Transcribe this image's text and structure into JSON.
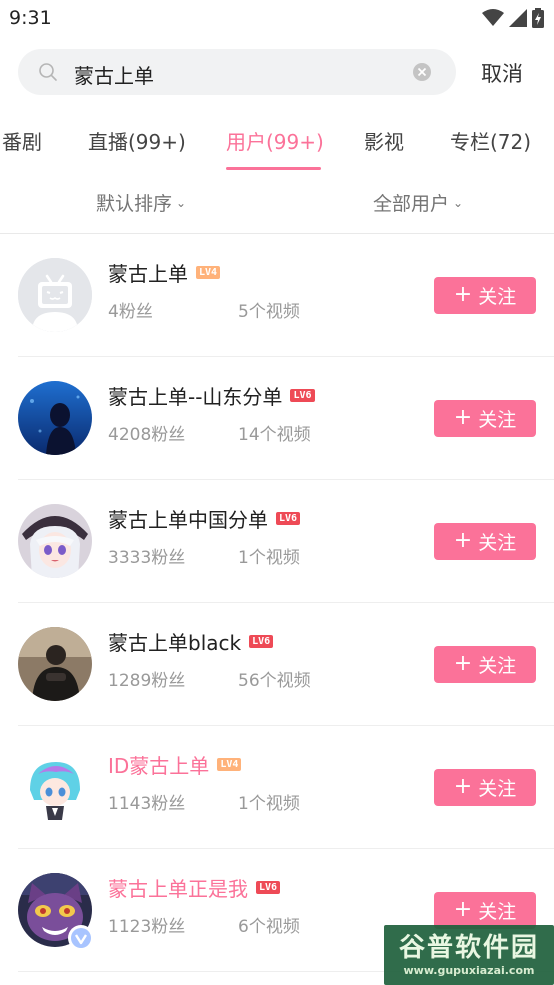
{
  "status": {
    "time": "9:31"
  },
  "search": {
    "query": "蒙古上单",
    "cancel_label": "取消"
  },
  "tabs": [
    {
      "label": "番剧"
    },
    {
      "label": "直播(99+)"
    },
    {
      "label": "用户(99+)"
    },
    {
      "label": "影视"
    },
    {
      "label": "专栏(72)"
    }
  ],
  "active_tab": "用户(99+)",
  "filters": {
    "sort_label": "默认排序",
    "type_label": "全部用户"
  },
  "users": [
    {
      "name": "蒙古上单",
      "level": "LV4",
      "fans": "4粉丝",
      "videos": "5个视频",
      "follow_label": "关注",
      "avatar": "default-tv-avatar"
    },
    {
      "name": "蒙古上单--山东分单",
      "level": "LV6",
      "fans": "4208粉丝",
      "videos": "14个视频",
      "follow_label": "关注",
      "avatar": "aquarium-photo-avatar"
    },
    {
      "name": "蒙古上单中国分单",
      "level": "LV6",
      "fans": "3333粉丝",
      "videos": "1个视频",
      "follow_label": "关注",
      "avatar": "anime-girl-avatar"
    },
    {
      "name": "蒙古上单black",
      "level": "LV6",
      "fans": "1289粉丝",
      "videos": "56个视频",
      "follow_label": "关注",
      "avatar": "man-photo-avatar"
    },
    {
      "name": "ID蒙古上单",
      "level": "LV4",
      "fans": "1143粉丝",
      "videos": "1个视频",
      "follow_label": "关注",
      "avatar": "anime-character-avatar"
    },
    {
      "name": "蒙古上单正是我",
      "level": "LV6",
      "fans": "1123粉丝",
      "videos": "6个视频",
      "follow_label": "关注",
      "avatar": "purple-cat-avatar"
    }
  ],
  "watermark": {
    "title": "谷普软件园",
    "url": "www.gupuxiazai.com"
  },
  "colors": {
    "accent": "#fb7299",
    "lv4": "#ffb27a",
    "lv6": "#ee4a56"
  }
}
